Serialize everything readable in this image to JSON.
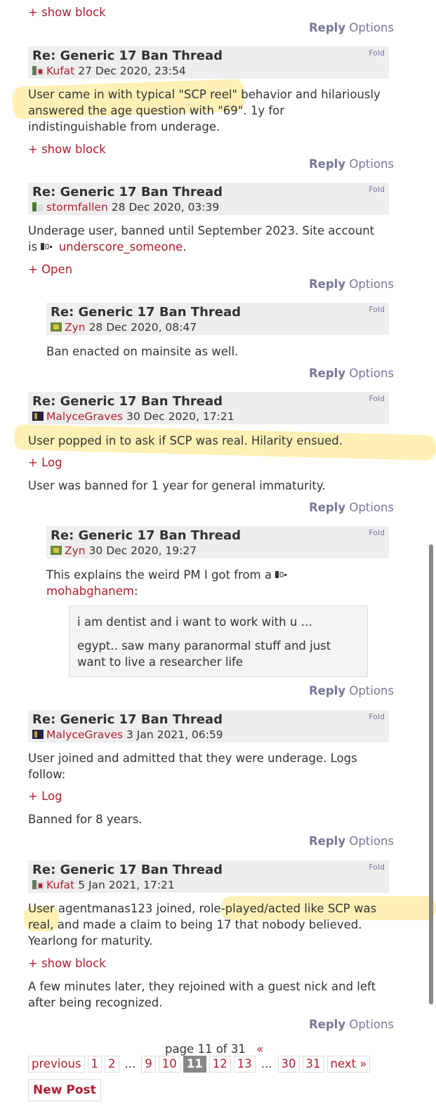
{
  "colors": {
    "link": "#b01e2f",
    "header_bg": "#eeeeee",
    "reply": "#777799",
    "highlight": "#ffe678"
  },
  "thread_title": "Re: Generic 17 Ban Thread",
  "fold_label": "Fold",
  "reply_label": "Reply",
  "options_label": "Options",
  "top": {
    "show_block": "+ show block"
  },
  "posts": [
    {
      "user": "Kufat",
      "date": "27 Dec 2020, 23:54",
      "body_lines": [
        "User came in with typical \"SCP reel\" behavior and hilariously",
        "answered the age question with \"69\". 1y for",
        "indistinguishable from underage."
      ],
      "toggle": "+ show block"
    },
    {
      "user": "stormfallen",
      "date": "28 Dec 2020, 03:39",
      "body_line1": "Underage user, banned until September 2023. Site account",
      "body_prefix": "is",
      "linked_user": "underscore_someone",
      "body_suffix": ".",
      "toggle": "+ Open"
    },
    {
      "user": "Zyn",
      "date": "28 Dec 2020, 08:47",
      "body": "Ban enacted on mainsite as well."
    },
    {
      "user": "MalyceGraves",
      "date": "30 Dec 2020, 17:21",
      "body": "User popped in to ask if SCP was real. Hilarity ensued.",
      "toggle": "+ Log",
      "body2": "User was banned for 1 year for general immaturity."
    },
    {
      "user": "Zyn",
      "date": "30 Dec 2020, 19:27",
      "body_line1": "This explains the weird PM I got from a",
      "linked_user": "mohabghanem",
      "body_suffix": ":",
      "quote_line1": "i am dentist and i want to work with u …",
      "quote_line2": "egypt.. saw many paranormal stuff and just",
      "quote_line3": "want to live a researcher life"
    },
    {
      "user": "MalyceGraves",
      "date": "3 Jan 2021, 06:59",
      "body_lines": [
        "User joined and admitted that they were underage. Logs",
        "follow:"
      ],
      "toggle": "+ Log",
      "body2": "Banned for 8 years."
    },
    {
      "user": "Kufat",
      "date": "5 Jan 2021, 17:21",
      "body_lines": [
        "User agentmanas123 joined, role-played/acted like SCP was",
        "real, and made a claim to being 17 that nobody believed.",
        "Yearlong for maturity."
      ],
      "toggle": "+ show block",
      "body2_lines": [
        "A few minutes later, they rejoined with a guest nick and left",
        "after being recognized."
      ]
    }
  ],
  "pager": {
    "status": "page 11 of 31",
    "collapse": "«",
    "previous": "previous",
    "pages": [
      "1",
      "2",
      "9",
      "10",
      "11",
      "12",
      "13",
      "30",
      "31"
    ],
    "dots": "...",
    "current": "11",
    "next": "next »"
  },
  "new_post": "New Post"
}
